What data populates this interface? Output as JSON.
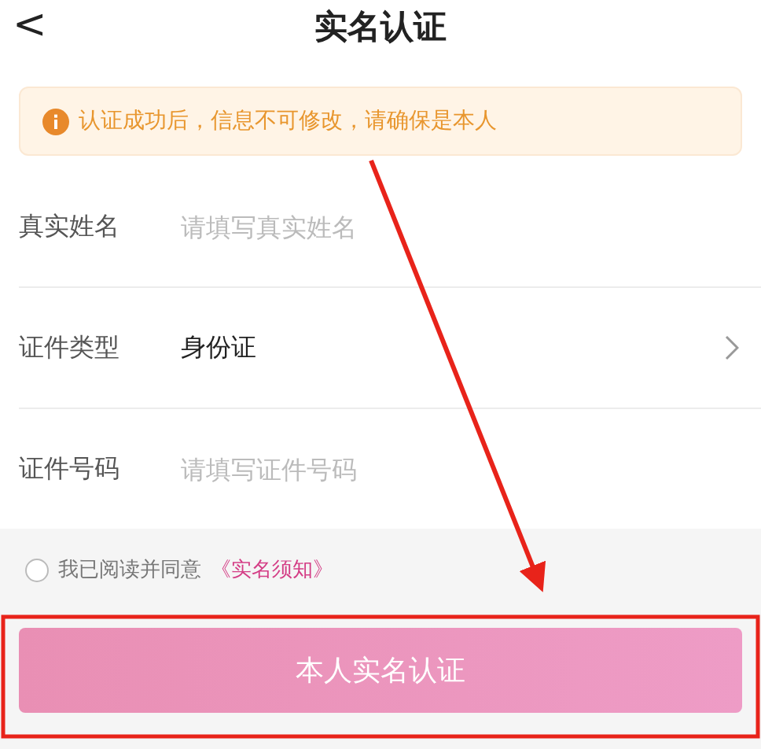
{
  "header": {
    "back": "<",
    "title": "实名认证"
  },
  "notice": {
    "text": "认证成功后，信息不可修改，请确保是本人"
  },
  "fields": [
    {
      "kind": "input",
      "label": "真实姓名",
      "placeholder": "请填写真实姓名"
    },
    {
      "kind": "select",
      "label": "证件类型",
      "value": "身份证"
    },
    {
      "kind": "input",
      "label": "证件号码",
      "placeholder": "请填写证件号码"
    }
  ],
  "agreement": {
    "checked": false,
    "text": "我已阅读并同意",
    "link": "《实名须知》"
  },
  "submit": {
    "label": "本人实名认证",
    "disabled": true
  }
}
